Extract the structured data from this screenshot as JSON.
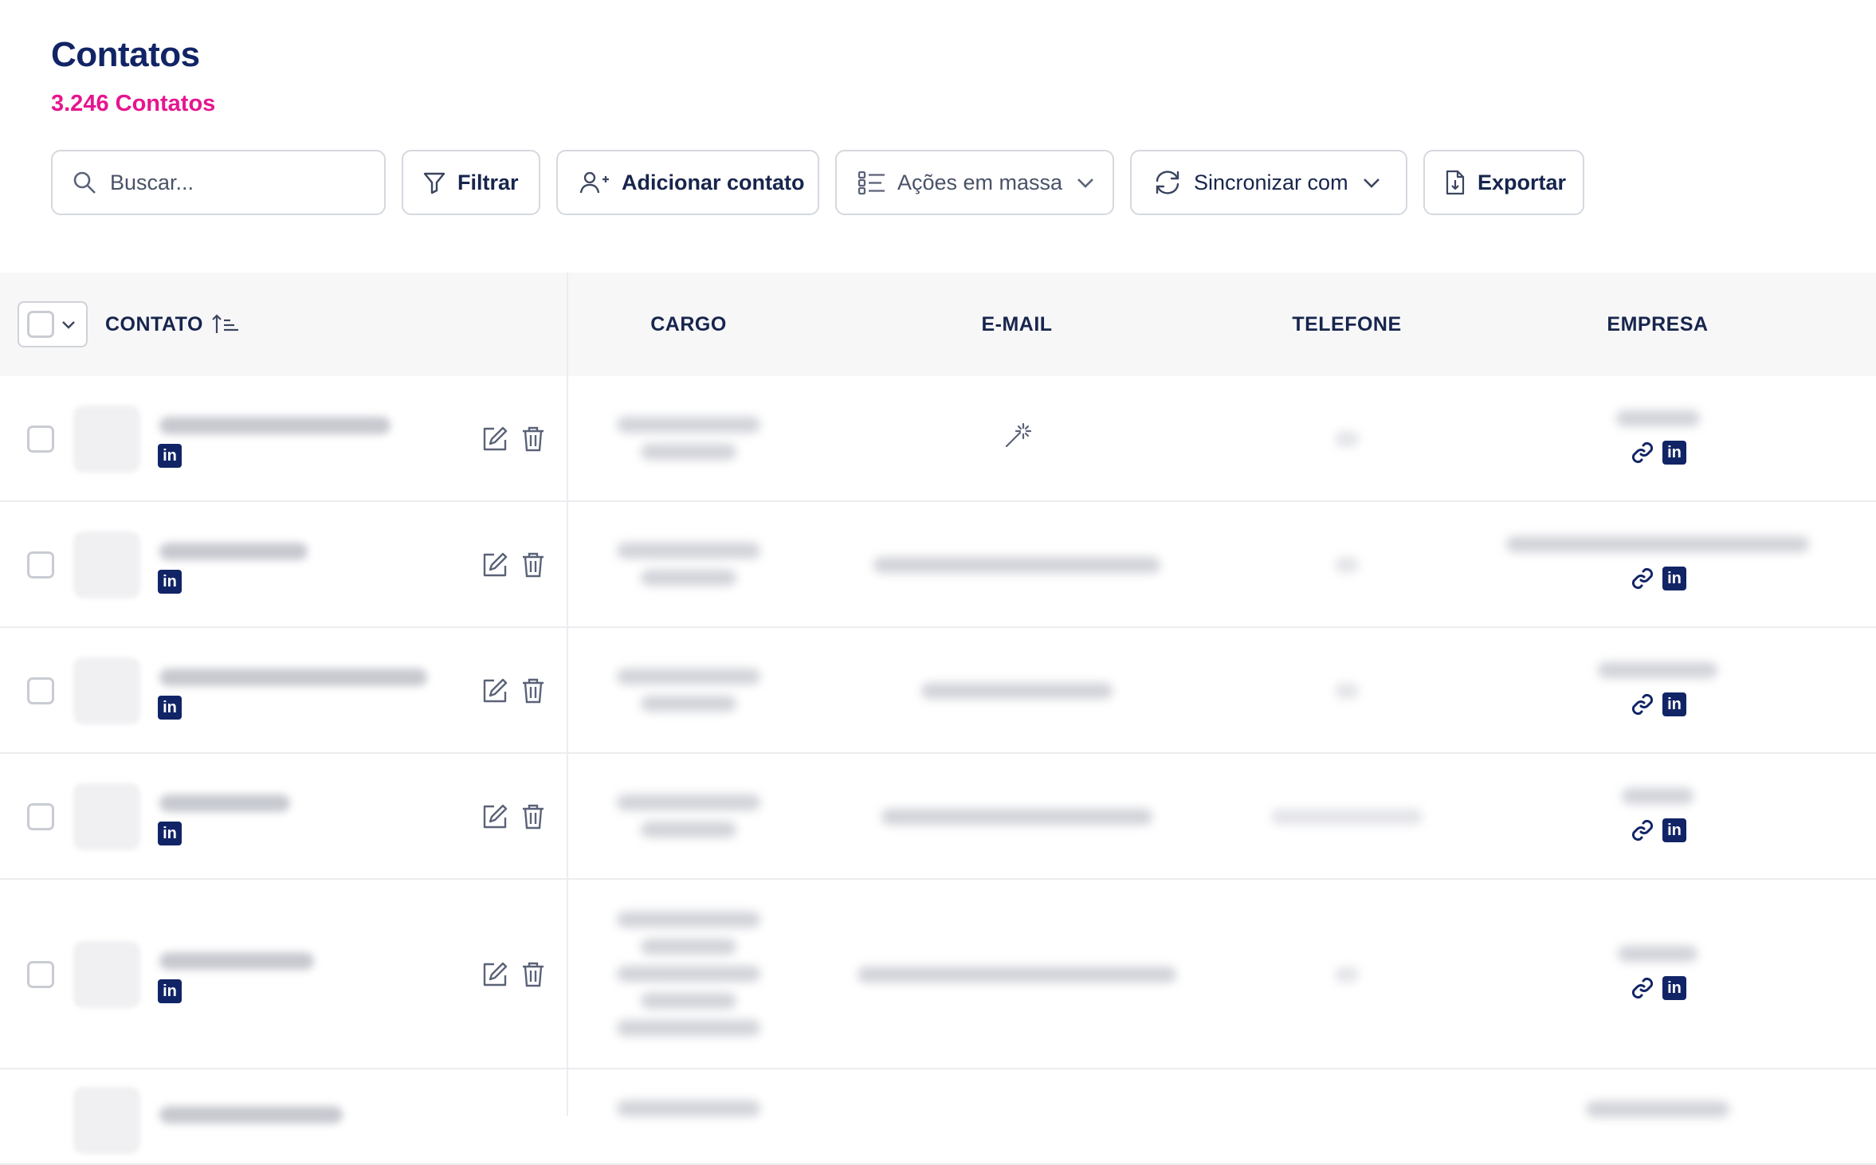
{
  "header": {
    "title": "Contatos",
    "count": "3.246 Contatos"
  },
  "toolbar": {
    "search_placeholder": "Buscar...",
    "filter_label": "Filtrar",
    "add_contact_label": "Adicionar contato",
    "bulk_actions_label": "Ações em massa",
    "sync_label": "Sincronizar com",
    "export_label": "Exportar"
  },
  "table": {
    "columns": [
      "CONTATO",
      "CARGO",
      "E-MAIL",
      "TELEFONE",
      "EMPRESA"
    ],
    "sort": {
      "column": "CONTATO",
      "direction": "ascending"
    },
    "rows_visible": 6
  },
  "icons": {
    "search": "search-icon",
    "filter": "filter-icon",
    "add": "add-user-icon",
    "bulk": "checklist-icon",
    "sync": "sync-icon",
    "export": "export-file-icon",
    "edit": "edit-icon",
    "delete": "trash-icon",
    "linkedin": "linkedin-icon",
    "link": "link-icon",
    "email_find": "magic-wand-icon"
  },
  "colors": {
    "title": "#112466",
    "accent": "#e6158f",
    "border": "#d5d8df",
    "header_bg": "#f7f7f8"
  }
}
